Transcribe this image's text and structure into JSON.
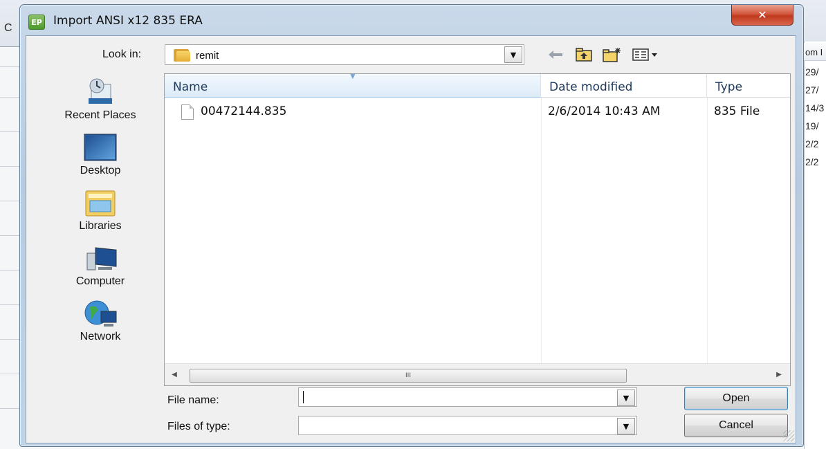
{
  "dialog": {
    "title": "Import ANSI x12 835 ERA",
    "title_icon_text": "EP",
    "close_icon": "close-icon"
  },
  "background": {
    "left_letter": "C",
    "right_header": "om I",
    "right_cells": [
      "29/",
      "27/",
      "14/3",
      "19/",
      "2/2",
      "2/2"
    ]
  },
  "lookin": {
    "label": "Look in:",
    "value": "remit",
    "toolbar_icons": [
      "back-arrow-icon",
      "up-folder-icon",
      "new-folder-icon",
      "view-menu-icon"
    ]
  },
  "places": [
    {
      "label": "Recent Places",
      "icon": "recent-places-icon"
    },
    {
      "label": "Desktop",
      "icon": "desktop-icon"
    },
    {
      "label": "Libraries",
      "icon": "libraries-icon"
    },
    {
      "label": "Computer",
      "icon": "computer-icon"
    },
    {
      "label": "Network",
      "icon": "network-icon"
    }
  ],
  "file_list": {
    "columns": [
      "Name",
      "Date modified",
      "Type"
    ],
    "rows": [
      {
        "name": "00472144.835",
        "date_modified": "2/6/2014 10:43 AM",
        "type": "835 File"
      }
    ],
    "scroll_thumb_label": "III"
  },
  "fields": {
    "file_name_label": "File name:",
    "file_name_value": "",
    "files_of_type_label": "Files of type:",
    "files_of_type_value": ""
  },
  "buttons": {
    "open": "Open",
    "cancel": "Cancel"
  }
}
